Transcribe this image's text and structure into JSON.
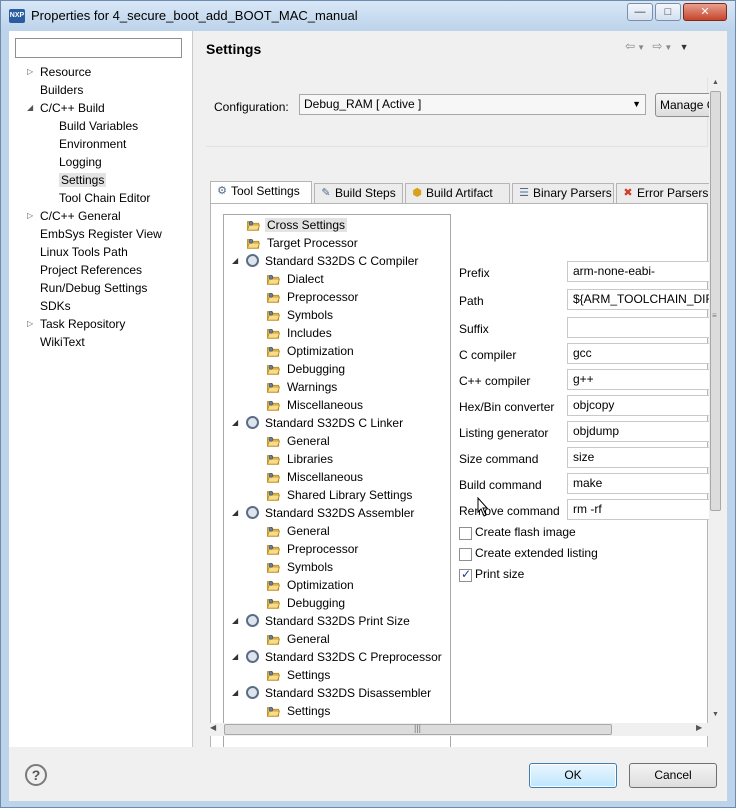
{
  "window": {
    "title": "Properties for 4_secure_boot_add_BOOT_MAC_manual",
    "app_icon_text": "NXP"
  },
  "filter": {
    "value": "",
    "placeholder": ""
  },
  "nav": [
    {
      "label": "Resource",
      "expand": "closed",
      "indent": 0
    },
    {
      "label": "Builders",
      "expand": "none",
      "indent": 0
    },
    {
      "label": "C/C++ Build",
      "expand": "open",
      "indent": 0
    },
    {
      "label": "Build Variables",
      "expand": "none",
      "indent": 1
    },
    {
      "label": "Environment",
      "expand": "none",
      "indent": 1
    },
    {
      "label": "Logging",
      "expand": "none",
      "indent": 1
    },
    {
      "label": "Settings",
      "expand": "none",
      "indent": 1,
      "selected": true
    },
    {
      "label": "Tool Chain Editor",
      "expand": "none",
      "indent": 1
    },
    {
      "label": "C/C++ General",
      "expand": "closed",
      "indent": 0
    },
    {
      "label": "EmbSys Register View",
      "expand": "none",
      "indent": 0
    },
    {
      "label": "Linux Tools Path",
      "expand": "none",
      "indent": 0
    },
    {
      "label": "Project References",
      "expand": "none",
      "indent": 0
    },
    {
      "label": "Run/Debug Settings",
      "expand": "none",
      "indent": 0
    },
    {
      "label": "SDKs",
      "expand": "none",
      "indent": 0
    },
    {
      "label": "Task Repository",
      "expand": "closed",
      "indent": 0
    },
    {
      "label": "WikiText",
      "expand": "none",
      "indent": 0
    }
  ],
  "settings": {
    "title": "Settings",
    "configuration_label": "Configuration:",
    "configuration_value": "Debug_RAM  [ Active ]",
    "manage_button": "Manage Configurations..."
  },
  "tabs": [
    {
      "label": "Tool Settings",
      "icon": "tool-settings-icon",
      "active": true
    },
    {
      "label": "Build Steps",
      "icon": "build-steps-icon"
    },
    {
      "label": "Build Artifact",
      "icon": "build-artifact-icon"
    },
    {
      "label": "Binary Parsers",
      "icon": "binary-parsers-icon"
    },
    {
      "label": "Error Parsers",
      "icon": "error-parsers-icon"
    }
  ],
  "tool_tree": [
    {
      "label": "Cross Settings",
      "kind": "folder",
      "indent": 0,
      "selected": true
    },
    {
      "label": "Target Processor",
      "kind": "folder",
      "indent": 0
    },
    {
      "label": "Standard S32DS C Compiler",
      "kind": "tool",
      "indent": 0
    },
    {
      "label": "Dialect",
      "kind": "folder",
      "indent": 1
    },
    {
      "label": "Preprocessor",
      "kind": "folder",
      "indent": 1
    },
    {
      "label": "Symbols",
      "kind": "folder",
      "indent": 1
    },
    {
      "label": "Includes",
      "kind": "folder",
      "indent": 1
    },
    {
      "label": "Optimization",
      "kind": "folder",
      "indent": 1
    },
    {
      "label": "Debugging",
      "kind": "folder",
      "indent": 1
    },
    {
      "label": "Warnings",
      "kind": "folder",
      "indent": 1
    },
    {
      "label": "Miscellaneous",
      "kind": "folder",
      "indent": 1
    },
    {
      "label": "Standard S32DS C Linker",
      "kind": "tool",
      "indent": 0
    },
    {
      "label": "General",
      "kind": "folder",
      "indent": 1
    },
    {
      "label": "Libraries",
      "kind": "folder",
      "indent": 1
    },
    {
      "label": "Miscellaneous",
      "kind": "folder",
      "indent": 1
    },
    {
      "label": "Shared Library Settings",
      "kind": "folder",
      "indent": 1
    },
    {
      "label": "Standard S32DS Assembler",
      "kind": "tool",
      "indent": 0
    },
    {
      "label": "General",
      "kind": "folder",
      "indent": 1
    },
    {
      "label": "Preprocessor",
      "kind": "folder",
      "indent": 1
    },
    {
      "label": "Symbols",
      "kind": "folder",
      "indent": 1
    },
    {
      "label": "Optimization",
      "kind": "folder",
      "indent": 1
    },
    {
      "label": "Debugging",
      "kind": "folder",
      "indent": 1
    },
    {
      "label": "Standard S32DS Print Size",
      "kind": "tool",
      "indent": 0
    },
    {
      "label": "General",
      "kind": "folder",
      "indent": 1
    },
    {
      "label": "Standard S32DS C Preprocessor",
      "kind": "tool",
      "indent": 0
    },
    {
      "label": "Settings",
      "kind": "folder",
      "indent": 1
    },
    {
      "label": "Standard S32DS Disassembler",
      "kind": "tool",
      "indent": 0
    },
    {
      "label": "Settings",
      "kind": "folder",
      "indent": 1
    }
  ],
  "fields": [
    {
      "label": "Prefix",
      "value": "arm-none-eabi-"
    },
    {
      "label": "Path",
      "value": "${ARM_TOOLCHAIN_DIR}/"
    },
    {
      "label": "Suffix",
      "value": ""
    },
    {
      "label": "C compiler",
      "value": "gcc"
    },
    {
      "label": "C++ compiler",
      "value": "g++"
    },
    {
      "label": "Hex/Bin converter",
      "value": "objcopy"
    },
    {
      "label": "Listing generator",
      "value": "objdump"
    },
    {
      "label": "Size command",
      "value": "size"
    },
    {
      "label": "Build command",
      "value": "make"
    },
    {
      "label": "Remove command",
      "value": "rm -rf"
    }
  ],
  "checkboxes": [
    {
      "label": "Create flash image",
      "checked": false
    },
    {
      "label": "Create extended listing",
      "checked": false
    },
    {
      "label": "Print size",
      "checked": true
    }
  ],
  "buttons": {
    "ok": "OK",
    "cancel": "Cancel",
    "help": "?"
  },
  "colors": {
    "title_bar": "#bcd3ea",
    "close_button": "#c8442c",
    "ok_border": "#3c7fb1"
  }
}
